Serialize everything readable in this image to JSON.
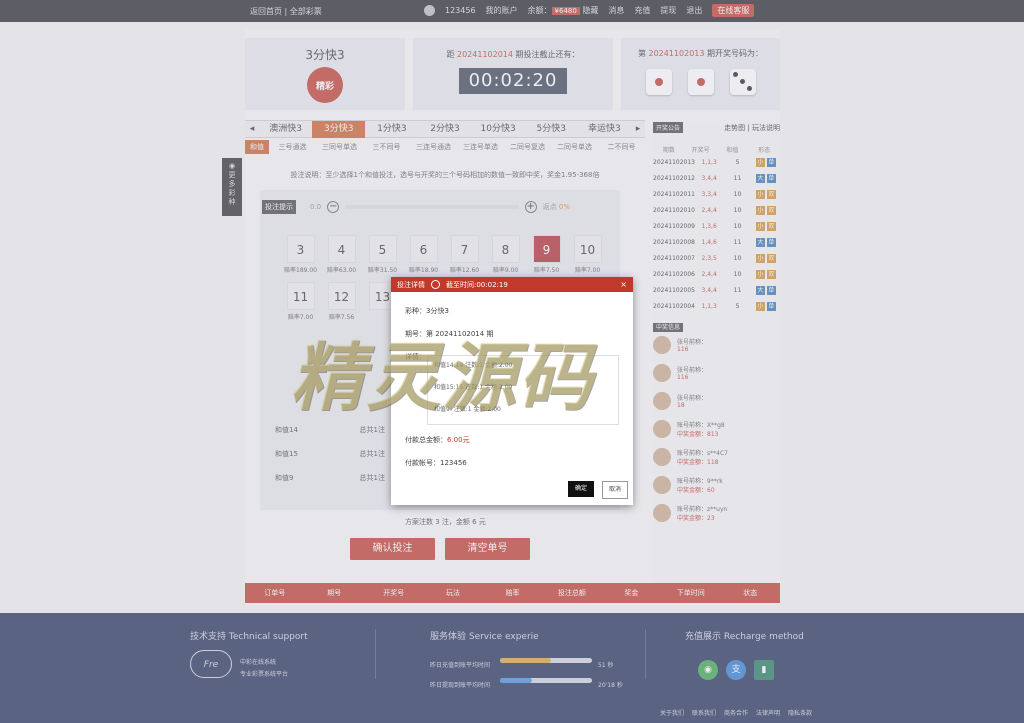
{
  "topbar": {
    "links": "返回首页 | 全部彩票",
    "user": "123456",
    "account": "我的账户",
    "balance_label": "余额",
    "balance_value": "¥6480",
    "hide": "隐藏",
    "message": "消息",
    "recharge": "充值",
    "withdraw": "提现",
    "logout": "退出",
    "support": "在线客服"
  },
  "game": {
    "name": "3分快3",
    "logo_text": "精彩"
  },
  "countdown": {
    "prefix": "距",
    "issue": "20241102014",
    "suffix": "期投注截止还有：",
    "time": "00:02:20"
  },
  "last_draw": {
    "prefix": "第",
    "issue": "20241102013",
    "suffix": "期开奖号码为："
  },
  "tabs": [
    "澳洲快3",
    "3分快3",
    "1分快3",
    "2分快3",
    "10分快3",
    "5分快3",
    "幸运快3"
  ],
  "subtabs": [
    "和值",
    "三号通选",
    "三同号单选",
    "三不同号",
    "三连号通选",
    "三连号单选",
    "二同号复选",
    "二同号单选",
    "二不同号"
  ],
  "instructions": "投注说明：至少选择1个和值投注，选号与开奖的三个号码相加的数值一致即中奖，奖金1.95-368倍",
  "quick_bet": "投注提示",
  "slider": {
    "left": "0.0",
    "right_label": "返点",
    "right_value": "0%"
  },
  "balls": [
    {
      "num": "3",
      "odds": "赔率189.00"
    },
    {
      "num": "4",
      "odds": "赔率63.00"
    },
    {
      "num": "5",
      "odds": "赔率31.50"
    },
    {
      "num": "6",
      "odds": "赔率18.90"
    },
    {
      "num": "7",
      "odds": "赔率12.60"
    },
    {
      "num": "8",
      "odds": "赔率9.00"
    },
    {
      "num": "9",
      "odds": "赔率7.50"
    },
    {
      "num": "10",
      "odds": "赔率7.00"
    },
    {
      "num": "11",
      "odds": "赔率7.00"
    },
    {
      "num": "12",
      "odds": "赔率7.56"
    },
    {
      "num": "13",
      "odds": ""
    }
  ],
  "picks": [
    {
      "a": "和值14",
      "b": "总共1注"
    },
    {
      "a": "和值15",
      "b": "总共1注"
    },
    {
      "a": "和值9",
      "b": "总共1注"
    }
  ],
  "summary": "方案注数 3 注，金额 6 元",
  "confirm": "确认投注",
  "clear": "清空单号",
  "sidebar": {
    "open_badge": "开奖公告",
    "links": "走势图 | 玩法说明",
    "cols": [
      "期数",
      "开奖号",
      "和值",
      "形态"
    ],
    "draws": [
      {
        "issue": "20241102013",
        "nums": "1,1,3",
        "sum": "5"
      },
      {
        "issue": "20241102012",
        "nums": "3,4,4",
        "sum": "11"
      },
      {
        "issue": "20241102011",
        "nums": "3,3,4",
        "sum": "10"
      },
      {
        "issue": "20241102010",
        "nums": "2,4,4",
        "sum": "10"
      },
      {
        "issue": "20241102009",
        "nums": "1,3,6",
        "sum": "10"
      },
      {
        "issue": "20241102008",
        "nums": "1,4,6",
        "sum": "11"
      },
      {
        "issue": "20241102007",
        "nums": "2,3,5",
        "sum": "10"
      },
      {
        "issue": "20241102006",
        "nums": "2,4,4",
        "sum": "10"
      },
      {
        "issue": "20241102005",
        "nums": "3,4,4",
        "sum": "11"
      },
      {
        "issue": "20241102004",
        "nums": "1,1,3",
        "sum": "5"
      }
    ],
    "win_badge": "中奖信息",
    "winners": [
      {
        "name": "张号前称：",
        "amount": "116"
      },
      {
        "name": "张号前称：",
        "amount": "116"
      },
      {
        "name": "张号前称：",
        "amount": "18"
      },
      {
        "name": "账号前称：X**g8",
        "amount": "中奖金额：813"
      },
      {
        "name": "账号前称：s**4C7",
        "amount": "中奖金额：118"
      },
      {
        "name": "账号前称：9**rk",
        "amount": "中奖金额：60"
      },
      {
        "name": "账号前称：z**uyn",
        "amount": "中奖金额：23"
      }
    ]
  },
  "order_cols": [
    "订单号",
    "期号",
    "开奖号",
    "玩法",
    "赔率",
    "投注总额",
    "奖金",
    "下单时间",
    "状态"
  ],
  "leftfloat": "更多彩种",
  "modal": {
    "title": "投注详情",
    "deadline": "截至时间:00:02:19",
    "lottery": "彩种：3分快3",
    "issue": "期号：第 20241102014 期",
    "detail_label": "详情：",
    "details": [
      "和值14:14  注数:1  金额:2.00",
      "和值15:15  注数:1  金额:2.00",
      "和值9:  注数:1  金额:2.00"
    ],
    "total_label": "付款总金额：",
    "total_value": "6.00元",
    "account": "付款帐号：123456",
    "ok": "确定",
    "cancel": "取消"
  },
  "watermark": "精灵源码",
  "footer": {
    "support_title": "技术支持 Technical support",
    "cloud_text": "Fre",
    "support_lines": [
      "中彩在线系统",
      "专业彩票系统平台"
    ],
    "service_title": "服务体验 Service experie",
    "service_rows": [
      {
        "label": "昨日充值到账平均时间",
        "value": "51 秒",
        "fill": 0.55
      },
      {
        "label": "昨日提现到账平均时间",
        "value": "20'18 秒",
        "fill": 0.35
      }
    ],
    "recharge_title": "充值展示 Recharge method",
    "links": [
      "关于我们",
      "联系我们",
      "商务合作",
      "法律声明",
      "隐私条款"
    ]
  },
  "colors": {
    "accent": "#c0392b",
    "footer": "#1f2e55",
    "tag_big": "#2e74b5",
    "tag_small": "#d8892b"
  }
}
